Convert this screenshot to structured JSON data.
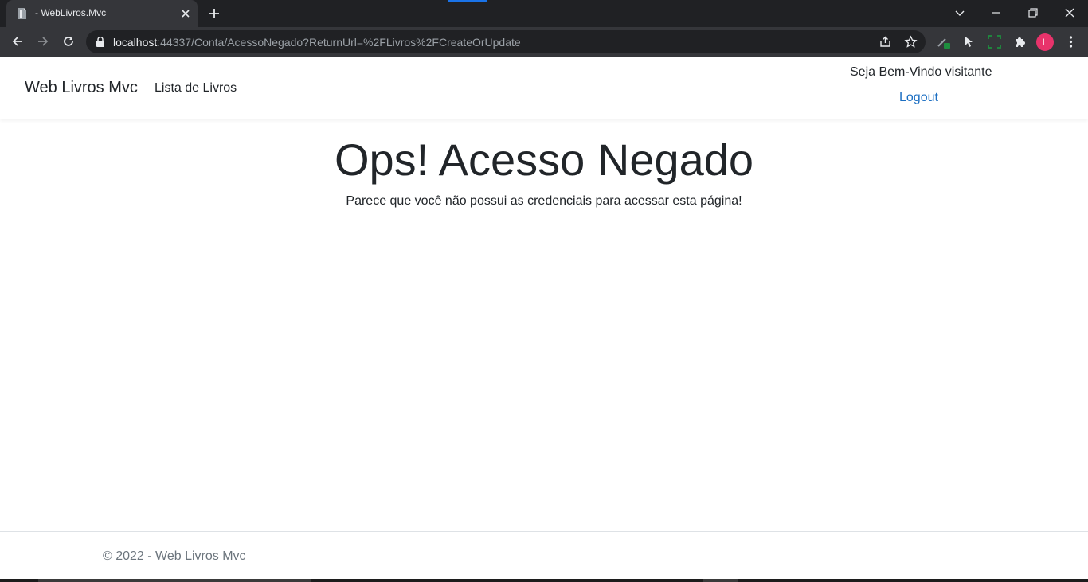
{
  "browser": {
    "tab_title": "- WebLivros.Mvc",
    "url_host": "localhost",
    "url_rest": ":44337/Conta/AcessoNegado?ReturnUrl=%2FLivros%2FCreateOrUpdate",
    "profile_initial": "L",
    "accent_color": "#1a73e8",
    "avatar_color": "#e8336b"
  },
  "navbar": {
    "brand": "Web Livros Mvc",
    "nav_link": "Lista de Livros",
    "welcome": "Seja Bem-Vindo visitante",
    "logout": "Logout"
  },
  "main": {
    "title": "Ops! Acesso Negado",
    "message": "Parece que você não possui as credenciais para acessar esta página!"
  },
  "footer": {
    "text": "© 2022 - Web Livros Mvc"
  },
  "colors": {
    "link": "#1b6ec2",
    "text": "#212529",
    "muted": "#6c757d"
  },
  "icons": [
    "document-icon",
    "close-icon",
    "plus-icon",
    "chevron-down-icon",
    "minimize-icon",
    "restore-icon",
    "window-close-icon",
    "back-arrow-icon",
    "forward-arrow-icon",
    "reload-icon",
    "lock-icon",
    "share-icon",
    "star-icon",
    "pen-extension-icon",
    "cursor-extension-icon",
    "screenshot-extension-icon",
    "puzzle-icon",
    "kebab-menu-icon"
  ]
}
